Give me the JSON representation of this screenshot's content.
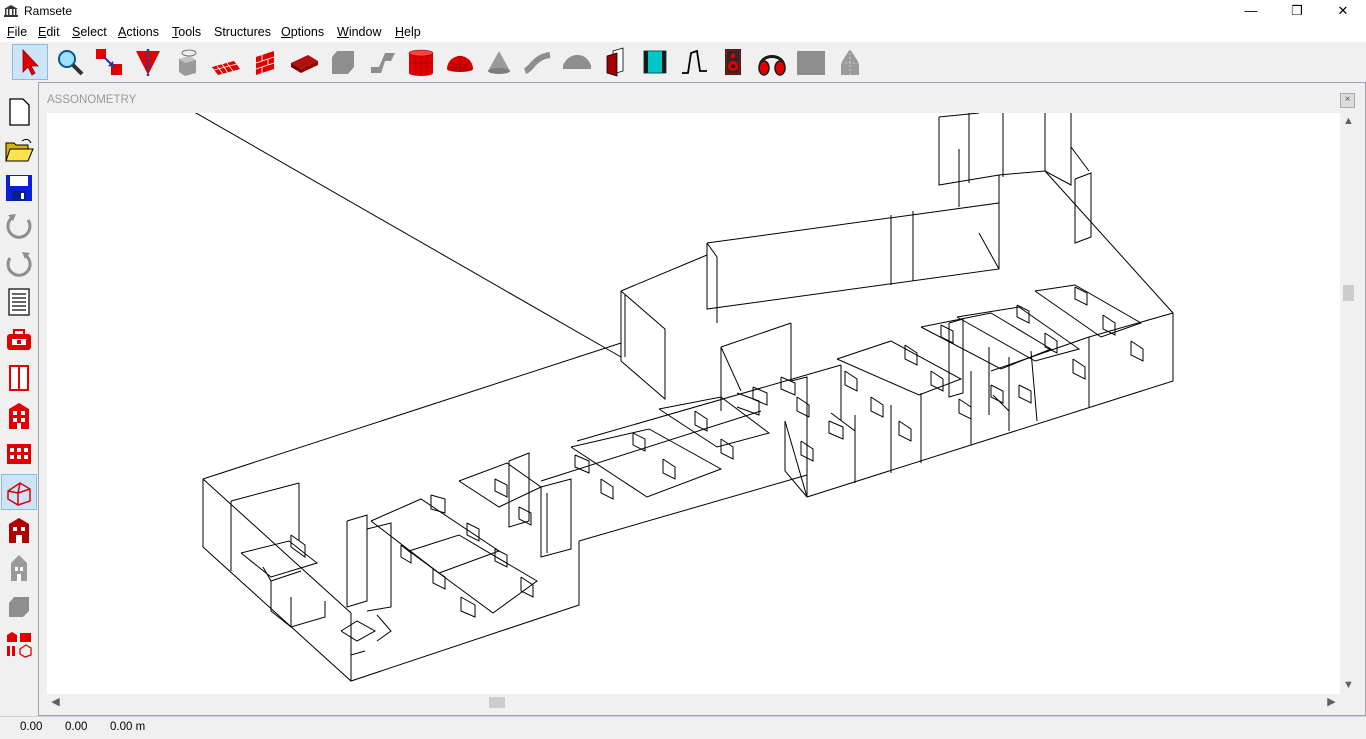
{
  "window": {
    "title": "Ramsete",
    "minimize": "—",
    "maximize": "❐",
    "close": "✕"
  },
  "menu": [
    {
      "label": "File",
      "u": "F",
      "rest": "ile"
    },
    {
      "label": "Edit",
      "u": "E",
      "rest": "dit"
    },
    {
      "label": "Select",
      "u": "S",
      "rest": "elect"
    },
    {
      "label": "Actions",
      "u": "A",
      "rest": "ctions"
    },
    {
      "label": "Tools",
      "u": "T",
      "rest": "ools"
    },
    {
      "label": "Structures",
      "u": "",
      "rest": "Structures"
    },
    {
      "label": "Options",
      "u": "O",
      "rest": "ptions"
    },
    {
      "label": "Window",
      "u": "W",
      "rest": "indow"
    },
    {
      "label": "Help",
      "u": "H",
      "rest": "elp"
    }
  ],
  "toolbar": {
    "icons": [
      "select-arrow-icon",
      "zoom-icon",
      "move-icon",
      "clip-plane-icon",
      "rotate-icon",
      "floor-grid-icon",
      "wall-bricks-icon",
      "slab-icon",
      "polygon-icon",
      "bent-surface-icon",
      "cylinder-icon",
      "dome-icon",
      "cone-icon",
      "curve-icon",
      "arch-icon",
      "door-icon",
      "panel-icon",
      "step-icon",
      "loudspeaker-icon",
      "headphones-icon",
      "gray-square-icon",
      "gray-tower-icon"
    ]
  },
  "lefttoolbar": {
    "icons": [
      "new-file-icon",
      "open-folder-icon",
      "save-icon",
      "undo-icon",
      "redo-icon",
      "list-icon",
      "toolbox-icon",
      "columns-icon",
      "building-icon",
      "grid-view-icon",
      "wireframe-house-icon",
      "building-red-icon",
      "tower-icon",
      "shape-icon",
      "multi-view-icon"
    ]
  },
  "child_window": {
    "title": "ASSONOMETRY",
    "close": "×"
  },
  "scroll": {
    "up": "▲",
    "down": "▼",
    "left": "◀",
    "right": "▶"
  },
  "status": {
    "x": "0.00",
    "y": "0.00",
    "z": "0.00 m"
  },
  "colors": {
    "accent_red": "#e00000",
    "selection_blue": "#cce4f7"
  }
}
